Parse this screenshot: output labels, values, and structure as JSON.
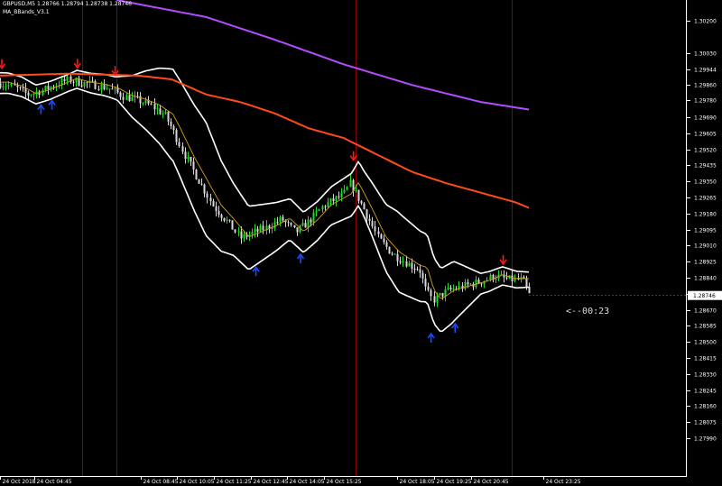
{
  "header": {
    "symbol_line": "GBPUSD,M5  1.28766  1.28794  1.28738  1.28746",
    "indicator_name": "MA_BBands_V3.1"
  },
  "countdown": "<--00:23",
  "colors": {
    "background": "#000000",
    "candle_up": "#1fdc1f",
    "candle_down": "#d6d6d6",
    "bands": "#ffffff",
    "band_middle": "#d4a017",
    "ma_slow": "#b24cff",
    "ma_fast": "#ff4a1c",
    "signal_up": "#1e4dff",
    "signal_down": "#ff1a1a",
    "vertical_lines": "#8b0000",
    "price_tag_bg": "#ffffff",
    "price_tag_text": "#000000"
  },
  "chart_data": {
    "type": "candlestick",
    "symbol": "GBPUSD",
    "timeframe": "M5",
    "current_price": "1.28746",
    "ylim": [
      1.2779,
      1.3031
    ],
    "price_ticks": [
      "1.30200",
      "1.30030",
      "1.29944",
      "1.29860",
      "1.29780",
      "1.29690",
      "1.29605",
      "1.29520",
      "1.29435",
      "1.29350",
      "1.29265",
      "1.29180",
      "1.29095",
      "1.29010",
      "1.28925",
      "1.28840",
      "1.28755",
      "1.28670",
      "1.28585",
      "1.28500",
      "1.28415",
      "1.28330",
      "1.28245",
      "1.28160",
      "1.28075",
      "1.27990"
    ],
    "time_ticks": [
      {
        "label": "24 Oct 2018",
        "t": 0
      },
      {
        "label": "24 Oct 04:45",
        "t": 0.0495
      },
      {
        "label": "24 Oct 08:45",
        "t": 0.205
      },
      {
        "label": "24 Oct 10:05",
        "t": 0.258
      },
      {
        "label": "24 Oct 11:25",
        "t": 0.312
      },
      {
        "label": "24 Oct 12:45",
        "t": 0.365
      },
      {
        "label": "24 Oct 14:05",
        "t": 0.418
      },
      {
        "label": "24 Oct 15:25",
        "t": 0.472
      },
      {
        "label": "24 Oct 18:05",
        "t": 0.578
      },
      {
        "label": "24 Oct 19:25",
        "t": 0.632
      },
      {
        "label": "24 Oct 20:45",
        "t": 0.686
      },
      {
        "label": "24 Oct 23:25",
        "t": 0.791
      }
    ],
    "bars": 190,
    "close_path": [
      [
        0,
        1.2987
      ],
      [
        0.02,
        1.2985
      ],
      [
        0.04,
        1.2981
      ],
      [
        0.06,
        1.2983
      ],
      [
        0.08,
        1.2986
      ],
      [
        0.1,
        1.2989
      ],
      [
        0.12,
        1.2987
      ],
      [
        0.14,
        1.2986
      ],
      [
        0.16,
        1.2984
      ],
      [
        0.18,
        1.298
      ],
      [
        0.2,
        1.2978
      ],
      [
        0.22,
        1.2975
      ],
      [
        0.24,
        1.297
      ],
      [
        0.25,
        1.2963
      ],
      [
        0.27,
        1.2948
      ],
      [
        0.29,
        1.2935
      ],
      [
        0.31,
        1.2922
      ],
      [
        0.33,
        1.2914
      ],
      [
        0.35,
        1.2905
      ],
      [
        0.37,
        1.2908
      ],
      [
        0.39,
        1.2911
      ],
      [
        0.41,
        1.2915
      ],
      [
        0.43,
        1.2908
      ],
      [
        0.45,
        1.2914
      ],
      [
        0.47,
        1.2922
      ],
      [
        0.5,
        1.2928
      ],
      [
        0.51,
        1.2934
      ],
      [
        0.53,
        1.292
      ],
      [
        0.55,
        1.2905
      ],
      [
        0.57,
        1.2897
      ],
      [
        0.6,
        1.289
      ],
      [
        0.61,
        1.2889
      ],
      [
        0.62,
        1.2877
      ],
      [
        0.63,
        1.2872
      ],
      [
        0.65,
        1.2877
      ],
      [
        0.68,
        1.288
      ],
      [
        0.7,
        1.2882
      ],
      [
        0.72,
        1.2885
      ],
      [
        0.74,
        1.2883
      ],
      [
        0.76,
        1.2883
      ],
      [
        0.77,
        1.2875
      ]
    ],
    "band_width_path": [
      [
        0,
        0.00055
      ],
      [
        0.1,
        0.00045
      ],
      [
        0.17,
        0.0006
      ],
      [
        0.25,
        0.0024
      ],
      [
        0.3,
        0.003
      ],
      [
        0.34,
        0.0019
      ],
      [
        0.42,
        0.0011
      ],
      [
        0.48,
        0.001
      ],
      [
        0.53,
        0.0012
      ],
      [
        0.58,
        0.0021
      ],
      [
        0.62,
        0.0018
      ],
      [
        0.66,
        0.0016
      ],
      [
        0.7,
        0.00055
      ],
      [
        0.77,
        0.0004
      ]
    ],
    "ma_slow": [
      [
        0.17,
        1.3031
      ],
      [
        0.3,
        1.3022
      ],
      [
        0.4,
        1.301
      ],
      [
        0.5,
        1.2997
      ],
      [
        0.6,
        1.2986
      ],
      [
        0.7,
        1.2977
      ],
      [
        0.77,
        1.2973
      ]
    ],
    "ma_fast": [
      [
        0,
        1.2991
      ],
      [
        0.1,
        1.2992
      ],
      [
        0.2,
        1.2991
      ],
      [
        0.25,
        1.2989
      ],
      [
        0.3,
        1.2981
      ],
      [
        0.35,
        1.2977
      ],
      [
        0.4,
        1.2971
      ],
      [
        0.45,
        1.2963
      ],
      [
        0.5,
        1.2958
      ],
      [
        0.55,
        1.2949
      ],
      [
        0.6,
        1.294
      ],
      [
        0.65,
        1.2934
      ],
      [
        0.7,
        1.2929
      ],
      [
        0.75,
        1.2924
      ],
      [
        0.77,
        1.2921
      ]
    ],
    "signals_down": [
      0.0,
      0.11,
      0.165,
      0.512,
      0.73
    ],
    "signals_up": [
      0.057,
      0.073,
      0.37,
      0.435,
      0.625,
      0.66
    ],
    "vertical_lines": [
      0.12,
      0.17,
      0.518,
      0.745
    ],
    "grid": false
  }
}
